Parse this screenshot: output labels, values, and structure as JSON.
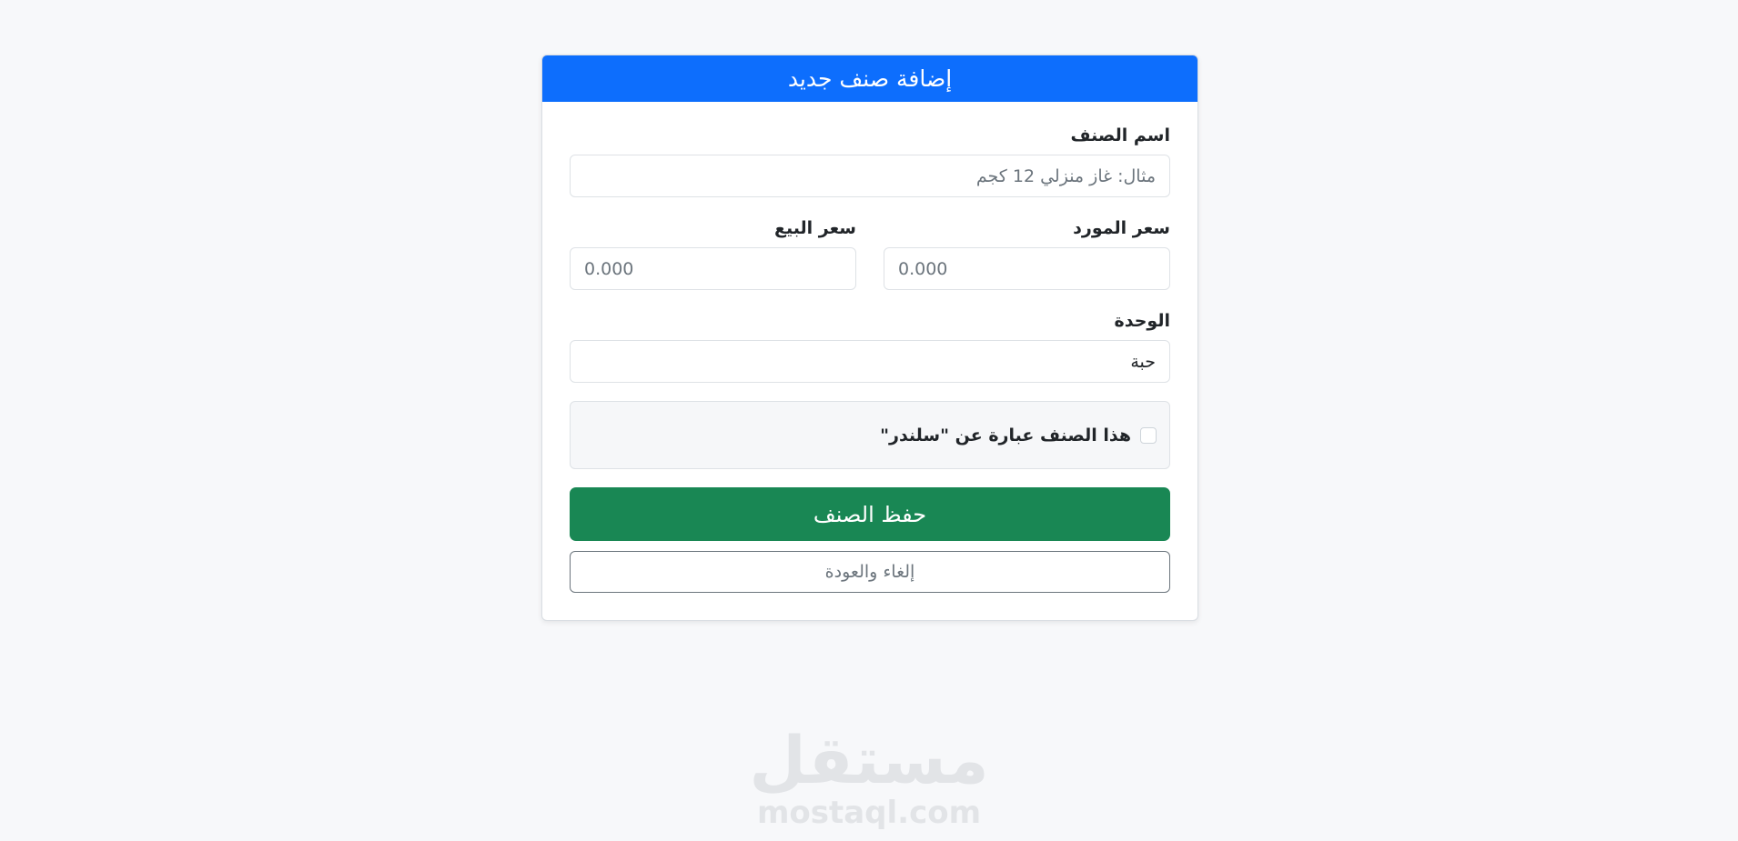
{
  "card": {
    "title": "إضافة صنف جديد"
  },
  "form": {
    "item_name": {
      "label": "اسم الصنف",
      "placeholder": "مثال: غاز منزلي 12 كجم",
      "value": ""
    },
    "supplier_price": {
      "label": "سعر المورد",
      "placeholder": "0.000"
    },
    "sale_price": {
      "label": "سعر البيع",
      "placeholder": "0.000"
    },
    "unit": {
      "label": "الوحدة",
      "value": "حبة"
    },
    "cylinder_checkbox": {
      "label": "هذا الصنف عبارة عن \"سلندر\"",
      "checked": false
    },
    "save_label": "حفظ الصنف",
    "cancel_label": "إلغاء والعودة"
  },
  "watermark": {
    "logo_text": "مستقل",
    "domain": "mostaql.com"
  },
  "colors": {
    "primary": "#0d6efd",
    "success": "#198754",
    "secondary": "#6c757d",
    "background": "#f7f8fa"
  }
}
